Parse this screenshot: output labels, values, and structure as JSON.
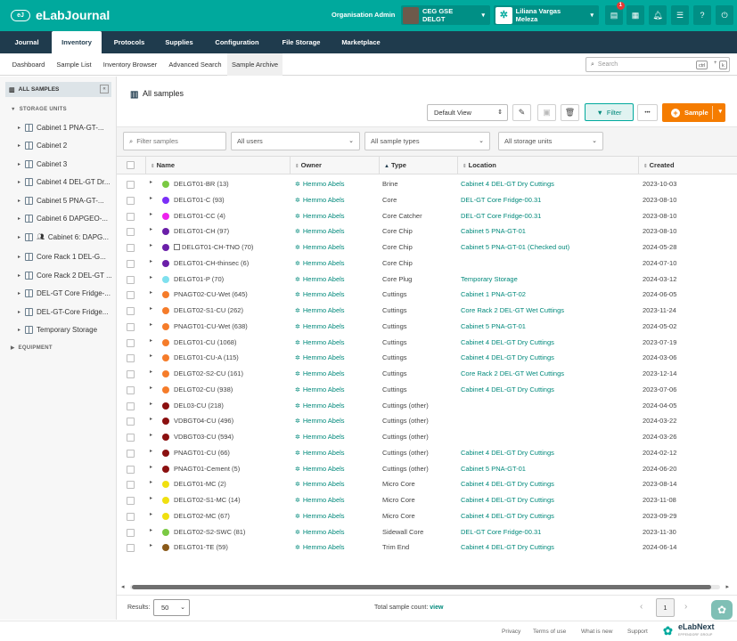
{
  "app": {
    "logo_badge": "eJ",
    "logo_text": "eLabJournal",
    "org_admin_label": "Organisation Admin",
    "group_label": "CEG GSE DELGT",
    "user_label": "Liliana Vargas Meleza",
    "notification_count": "1",
    "brand_color": "#00a99d",
    "nav_color": "#1f3b4d"
  },
  "main_nav": [
    "Journal",
    "Inventory",
    "Protocols",
    "Supplies",
    "Configuration",
    "File Storage",
    "Marketplace"
  ],
  "sub_nav": [
    "Dashboard",
    "Sample List",
    "Inventory Browser",
    "Advanced Search",
    "Sample Archive"
  ],
  "search": {
    "placeholder": "Search",
    "kbd1": "ctrl",
    "plus": "+",
    "kbd2": "k"
  },
  "sidebar": {
    "all_samples": "ALL SAMPLES",
    "storage_units_heading": "STORAGE UNITS",
    "equipment_heading": "EQUIPMENT",
    "items": [
      "Cabinet 1 PNA-GT-...",
      "Cabinet 2",
      "Cabinet 3",
      "Cabinet 4 DEL-GT Dr...",
      "Cabinet 5 PNA-GT-...",
      "Cabinet 6 DAPGEO-...",
      "Cabinet 6: DAPG...",
      "Core Rack 1 DEL-G...",
      "Core Rack 2 DEL-GT ...",
      "DEL-GT Core Fridge-...",
      "DEL-GT-Core Fridge...",
      "Temporary Storage"
    ]
  },
  "toolbar": {
    "title": "All samples",
    "view_select": "Default View",
    "filter_label": "Filter",
    "more_label": "•••",
    "sample_label": "Sample"
  },
  "filters": {
    "filter_placeholder": "Filter samples",
    "users": "All users",
    "types": "All sample types",
    "storage": "All storage units"
  },
  "table": {
    "headers": {
      "name": "Name",
      "owner": "Owner",
      "type": "Type",
      "location": "Location",
      "created": "Created"
    },
    "rows": [
      {
        "name": "DELGT01-BR (13)",
        "color": "#7ac943",
        "owner": "Hemmo Abels",
        "type": "Brine",
        "location": "Cabinet 4 DEL-GT Dry Cuttings",
        "created": "2023-10-03",
        "box": false
      },
      {
        "name": "DELGT01-C (93)",
        "color": "#7b2ff7",
        "owner": "Hemmo Abels",
        "type": "Core",
        "location": "DEL-GT Core Fridge-00.31",
        "created": "2023-08-10",
        "box": false
      },
      {
        "name": "DELGT01-CC (4)",
        "color": "#ee22ee",
        "owner": "Hemmo Abels",
        "type": "Core Catcher",
        "location": "DEL-GT Core Fridge-00.31",
        "created": "2023-08-10",
        "box": false
      },
      {
        "name": "DELGT01-CH (97)",
        "color": "#6a1fa8",
        "owner": "Hemmo Abels",
        "type": "Core Chip",
        "location": "Cabinet 5 PNA-GT-01",
        "created": "2023-08-10",
        "box": false
      },
      {
        "name": "DELGT01-CH-TNO (70)",
        "color": "#6a1fa8",
        "owner": "Hemmo Abels",
        "type": "Core Chip",
        "location": "Cabinet 5 PNA-GT-01 (Checked out)",
        "created": "2024-05-28",
        "box": true
      },
      {
        "name": "DELGT01-CH-thinsec (6)",
        "color": "#6a1fa8",
        "owner": "Hemmo Abels",
        "type": "Core Chip",
        "location": "",
        "created": "2024-07-10",
        "box": false
      },
      {
        "name": "DELGT01-P (70)",
        "color": "#7fe0ee",
        "owner": "Hemmo Abels",
        "type": "Core Plug",
        "location": "Temporary Storage",
        "created": "2024-03-12",
        "box": false
      },
      {
        "name": "PNAGT02-CU-Wet (645)",
        "color": "#f57c2a",
        "owner": "Hemmo Abels",
        "type": "Cuttings",
        "location": "Cabinet 1 PNA-GT-02",
        "created": "2024-06-05",
        "box": false
      },
      {
        "name": "DELGT02-S1-CU (262)",
        "color": "#f57c2a",
        "owner": "Hemmo Abels",
        "type": "Cuttings",
        "location": "Core Rack 2 DEL-GT Wet Cuttings",
        "created": "2023-11-24",
        "box": false
      },
      {
        "name": "PNAGT01-CU-Wet (638)",
        "color": "#f57c2a",
        "owner": "Hemmo Abels",
        "type": "Cuttings",
        "location": "Cabinet 5 PNA-GT-01",
        "created": "2024-05-02",
        "box": false
      },
      {
        "name": "DELGT01-CU (1068)",
        "color": "#f57c2a",
        "owner": "Hemmo Abels",
        "type": "Cuttings",
        "location": "Cabinet 4 DEL-GT Dry Cuttings",
        "created": "2023-07-19",
        "box": false
      },
      {
        "name": "DELGT01-CU-A (115)",
        "color": "#f57c2a",
        "owner": "Hemmo Abels",
        "type": "Cuttings",
        "location": "Cabinet 4 DEL-GT Dry Cuttings",
        "created": "2024-03-06",
        "box": false
      },
      {
        "name": "DELGT02-S2-CU (161)",
        "color": "#f57c2a",
        "owner": "Hemmo Abels",
        "type": "Cuttings",
        "location": "Core Rack 2 DEL-GT Wet Cuttings",
        "created": "2023-12-14",
        "box": false
      },
      {
        "name": "DELGT02-CU (938)",
        "color": "#f57c2a",
        "owner": "Hemmo Abels",
        "type": "Cuttings",
        "location": "Cabinet 4 DEL-GT Dry Cuttings",
        "created": "2023-07-06",
        "box": false
      },
      {
        "name": "DEL03-CU (218)",
        "color": "#8b1010",
        "owner": "Hemmo Abels",
        "type": "Cuttings (other)",
        "location": "",
        "created": "2024-04-05",
        "box": false
      },
      {
        "name": "VDBGT04-CU (496)",
        "color": "#8b1010",
        "owner": "Hemmo Abels",
        "type": "Cuttings (other)",
        "location": "",
        "created": "2024-03-22",
        "box": false
      },
      {
        "name": "VDBGT03-CU (594)",
        "color": "#8b1010",
        "owner": "Hemmo Abels",
        "type": "Cuttings (other)",
        "location": "",
        "created": "2024-03-26",
        "box": false
      },
      {
        "name": "PNAGT01-CU (66)",
        "color": "#8b1010",
        "owner": "Hemmo Abels",
        "type": "Cuttings (other)",
        "location": "Cabinet 4 DEL-GT Dry Cuttings",
        "created": "2024-02-12",
        "box": false
      },
      {
        "name": "PNAGT01-Cement (5)",
        "color": "#8b1010",
        "owner": "Hemmo Abels",
        "type": "Cuttings (other)",
        "location": "Cabinet 5 PNA-GT-01",
        "created": "2024-06-20",
        "box": false
      },
      {
        "name": "DELGT01-MC (2)",
        "color": "#f0e010",
        "owner": "Hemmo Abels",
        "type": "Micro Core",
        "location": "Cabinet 4 DEL-GT Dry Cuttings",
        "created": "2023-08-14",
        "box": false
      },
      {
        "name": "DELGT02-S1-MC (14)",
        "color": "#f0e010",
        "owner": "Hemmo Abels",
        "type": "Micro Core",
        "location": "Cabinet 4 DEL-GT Dry Cuttings",
        "created": "2023-11-08",
        "box": false
      },
      {
        "name": "DELGT02-MC (67)",
        "color": "#f0e010",
        "owner": "Hemmo Abels",
        "type": "Micro Core",
        "location": "Cabinet 4 DEL-GT Dry Cuttings",
        "created": "2023-09-29",
        "box": false
      },
      {
        "name": "DELGT02-S2-SWC (81)",
        "color": "#7ac943",
        "owner": "Hemmo Abels",
        "type": "Sidewall Core",
        "location": "DEL-GT Core Fridge-00.31",
        "created": "2023-11-30",
        "box": false
      },
      {
        "name": "DELGT01-TE (59)",
        "color": "#8a5a1a",
        "owner": "Hemmo Abels",
        "type": "Trim End",
        "location": "Cabinet 4 DEL-GT Dry Cuttings",
        "created": "2024-06-14",
        "box": false
      }
    ]
  },
  "table_footer": {
    "results_label": "Results:",
    "results_value": "50",
    "total_label": "Total sample count:",
    "total_link": "view",
    "page": "1"
  },
  "page_footer": {
    "links": [
      "Privacy",
      "Terms of use",
      "What is new",
      "Support"
    ],
    "brand": "eLabNext",
    "brand_sub": "EPPENDORF GROUP"
  }
}
